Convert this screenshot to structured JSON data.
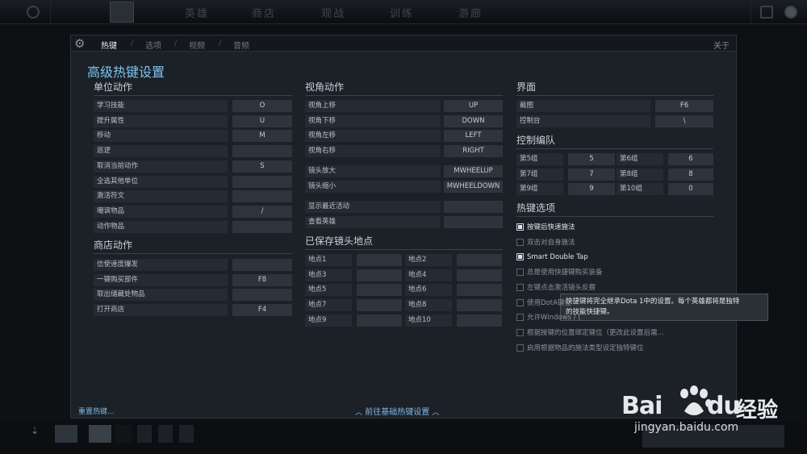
{
  "topbar": {
    "menu": [
      "英雄",
      "商店",
      "观战",
      "训练",
      "游廊"
    ]
  },
  "tabs": {
    "items": [
      "热键",
      "选项",
      "视频",
      "音频"
    ],
    "about": "关于"
  },
  "title": "高级热键设置",
  "unit_actions": {
    "title": "单位动作",
    "rows": [
      {
        "label": "学习技能",
        "key": "O"
      },
      {
        "label": "提升属性",
        "key": "U"
      },
      {
        "label": "移动",
        "key": "M"
      },
      {
        "label": "巡逻",
        "key": ""
      },
      {
        "label": "取消当前动作",
        "key": "S"
      },
      {
        "label": "全选其他单位",
        "key": ""
      },
      {
        "label": "激活符文",
        "key": ""
      },
      {
        "label": "嘲讽物品",
        "key": "/"
      },
      {
        "label": "动作物品",
        "key": ""
      }
    ]
  },
  "shop_actions": {
    "title": "商店动作",
    "rows": [
      {
        "label": "信使速度爆发",
        "key": ""
      },
      {
        "label": "一键购买部件",
        "key": "F8"
      },
      {
        "label": "取出储藏处物品",
        "key": ""
      },
      {
        "label": "打开商店",
        "key": "F4"
      }
    ]
  },
  "camera_actions": {
    "title": "视角动作",
    "rows": [
      {
        "label": "视角上移",
        "key": "UP"
      },
      {
        "label": "视角下移",
        "key": "DOWN"
      },
      {
        "label": "视角左移",
        "key": "LEFT"
      },
      {
        "label": "视角右移",
        "key": "RIGHT"
      }
    ],
    "rows2": [
      {
        "label": "镜头放大",
        "key": "MWHEELUP"
      },
      {
        "label": "镜头缩小",
        "key": "MWHEELDOWN"
      }
    ],
    "rows3": [
      {
        "label": "显示最近活动",
        "key": ""
      },
      {
        "label": "查看英雄",
        "key": ""
      }
    ]
  },
  "saved_camera": {
    "title": "已保存镜头地点",
    "rows": [
      [
        {
          "label": "地点1",
          "key": ""
        },
        {
          "label": "地点2",
          "key": ""
        }
      ],
      [
        {
          "label": "地点3",
          "key": ""
        },
        {
          "label": "地点4",
          "key": ""
        }
      ],
      [
        {
          "label": "地点5",
          "key": ""
        },
        {
          "label": "地点6",
          "key": ""
        }
      ],
      [
        {
          "label": "地点7",
          "key": ""
        },
        {
          "label": "地点8",
          "key": ""
        }
      ],
      [
        {
          "label": "地点9",
          "key": ""
        },
        {
          "label": "地点10",
          "key": ""
        }
      ]
    ]
  },
  "interface": {
    "title": "界面",
    "rows": [
      {
        "label": "截图",
        "key": "F6"
      },
      {
        "label": "控制台",
        "key": "\\"
      }
    ]
  },
  "control_groups": {
    "title": "控制编队",
    "rows": [
      [
        {
          "label": "第5组",
          "key": "5"
        },
        {
          "label": "第6组",
          "key": "6"
        }
      ],
      [
        {
          "label": "第7组",
          "key": "7"
        },
        {
          "label": "第8组",
          "key": "8"
        }
      ],
      [
        {
          "label": "第9组",
          "key": "9"
        },
        {
          "label": "第10组",
          "key": "0"
        }
      ]
    ]
  },
  "hotkey_options": {
    "title": "热键选项",
    "items": [
      {
        "label": "按键后快速施法",
        "checked": true
      },
      {
        "label": "双击对自身施法",
        "checked": false
      },
      {
        "label": "Smart Double Tap",
        "checked": true
      },
      {
        "label": "总是使用快捷键购买装备",
        "checked": false
      },
      {
        "label": "左键点击激活镜头反握",
        "checked": false
      },
      {
        "label": "使用DotA键位",
        "checked": false
      },
      {
        "label": "允许Windows / (",
        "checked": false
      },
      {
        "label": "根据按键的位置绑定键位（更改此设置后需...",
        "checked": false
      },
      {
        "label": "启用根据物品的施法类型设定独特键位",
        "checked": false
      }
    ]
  },
  "tooltip": {
    "line1": "快捷键将完全继承Dota 1中的设置。每个英雄都将是独特",
    "line2": "的技能快捷键。"
  },
  "footer": {
    "reset": "重置热键...",
    "basic": "前往基础热键设置"
  },
  "watermark": {
    "brand": "Bai",
    "brand2": "经验",
    "url": "jingyan.baidu.com"
  },
  "colors": {
    "accent": "#7fc4f0",
    "panel": "#1c2128"
  }
}
